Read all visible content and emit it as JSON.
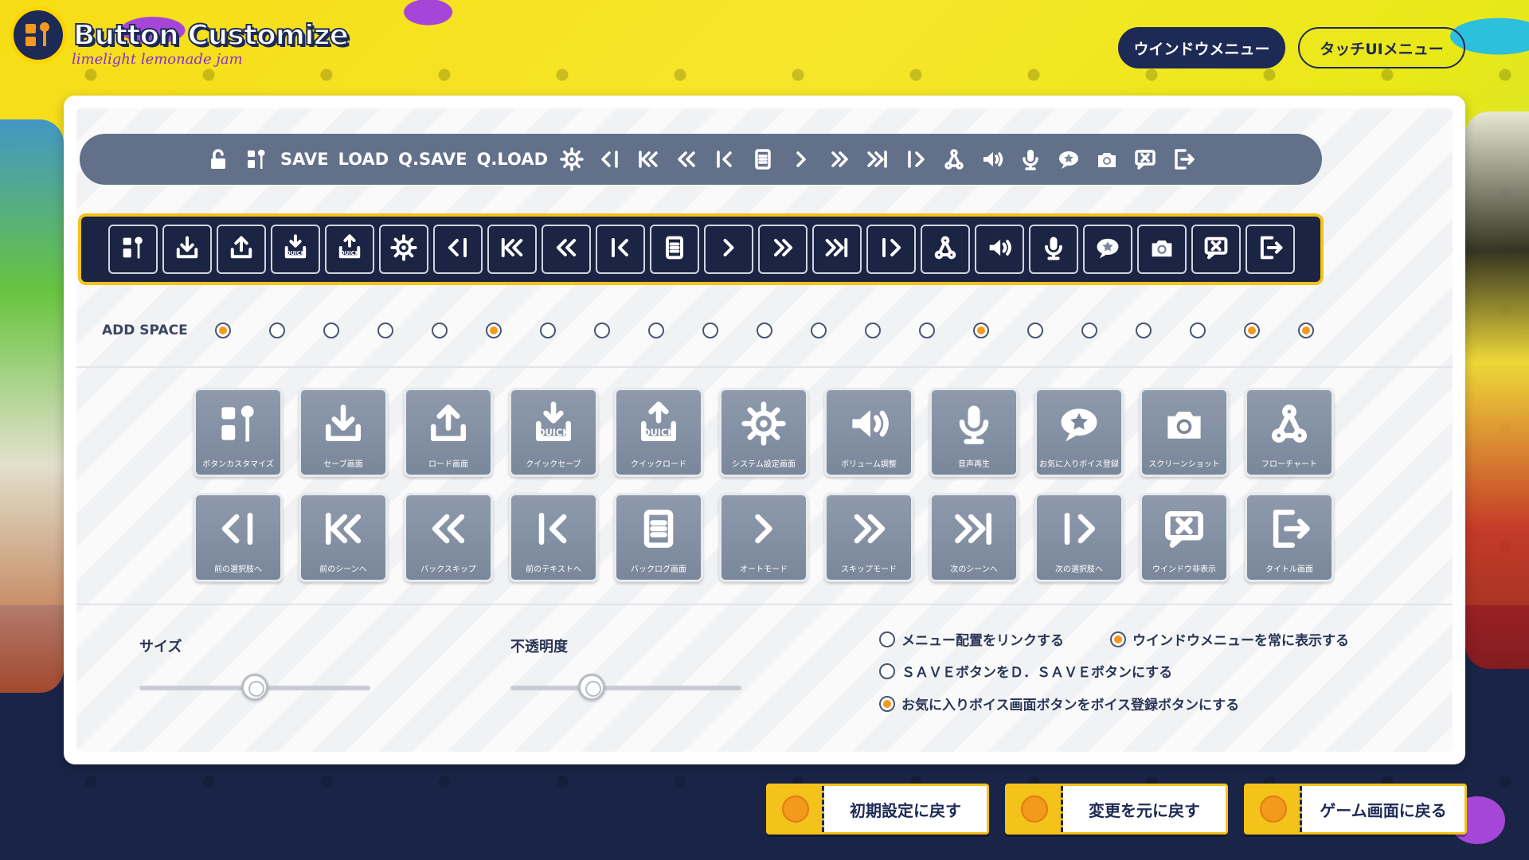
{
  "app": {
    "title": "Button Customize",
    "subtitle": "limelight lemonade jam"
  },
  "header": {
    "tabs": [
      {
        "label": "ウインドウメニュー",
        "active": true
      },
      {
        "label": "タッチUIメニュー",
        "active": false
      }
    ]
  },
  "preview_bar": {
    "items": [
      {
        "type": "icon",
        "icon": "lock-open-icon"
      },
      {
        "type": "icon",
        "icon": "button-customize-icon"
      },
      {
        "type": "text",
        "label": "SAVE"
      },
      {
        "type": "text",
        "label": "LOAD"
      },
      {
        "type": "text",
        "label": "Q.SAVE"
      },
      {
        "type": "text",
        "label": "Q.LOAD"
      },
      {
        "type": "icon",
        "icon": "gear-icon"
      },
      {
        "type": "icon",
        "icon": "prev-choice-icon"
      },
      {
        "type": "icon",
        "icon": "prev-scene-icon"
      },
      {
        "type": "icon",
        "icon": "back-skip-icon"
      },
      {
        "type": "icon",
        "icon": "prev-text-icon"
      },
      {
        "type": "icon",
        "icon": "backlog-icon"
      },
      {
        "type": "icon",
        "icon": "auto-icon"
      },
      {
        "type": "icon",
        "icon": "skip-icon"
      },
      {
        "type": "icon",
        "icon": "next-scene-icon"
      },
      {
        "type": "icon",
        "icon": "next-choice-icon"
      },
      {
        "type": "icon",
        "icon": "flowchart-icon"
      },
      {
        "type": "icon",
        "icon": "volume-icon"
      },
      {
        "type": "icon",
        "icon": "microphone-icon"
      },
      {
        "type": "icon",
        "icon": "favorite-voice-icon"
      },
      {
        "type": "icon",
        "icon": "camera-icon"
      },
      {
        "type": "icon",
        "icon": "hide-window-icon"
      },
      {
        "type": "icon",
        "icon": "exit-title-icon"
      }
    ]
  },
  "slots": [
    "button-customize-icon",
    "save-icon",
    "load-icon",
    "quick-save-icon",
    "quick-load-icon",
    "gear-icon",
    "prev-choice-icon",
    "prev-scene-icon",
    "back-skip-icon",
    "prev-text-icon",
    "backlog-icon",
    "auto-icon",
    "skip-icon",
    "next-scene-icon",
    "next-choice-icon",
    "flowchart-icon",
    "volume-icon",
    "microphone-icon",
    "favorite-voice-icon",
    "camera-icon",
    "hide-window-icon",
    "exit-title-icon"
  ],
  "add_space": {
    "label": "ADD SPACE",
    "states": [
      true,
      false,
      false,
      false,
      false,
      true,
      false,
      false,
      false,
      false,
      false,
      false,
      false,
      false,
      true,
      false,
      false,
      false,
      false,
      true,
      true
    ]
  },
  "palette": {
    "row1": [
      {
        "icon": "button-customize-icon",
        "label": "ボタンカスタマイズ"
      },
      {
        "icon": "save-icon",
        "label": "セーブ画面"
      },
      {
        "icon": "load-icon",
        "label": "ロード画面"
      },
      {
        "icon": "quick-save-icon",
        "label": "クイックセーブ"
      },
      {
        "icon": "quick-load-icon",
        "label": "クイックロード"
      },
      {
        "icon": "gear-icon",
        "label": "システム設定画面"
      },
      {
        "icon": "volume-icon",
        "label": "ボリューム調整"
      },
      {
        "icon": "microphone-icon",
        "label": "音声再生"
      },
      {
        "icon": "favorite-voice-icon",
        "label": "お気に入りボイス登録"
      },
      {
        "icon": "camera-icon",
        "label": "スクリーンショット"
      },
      {
        "icon": "flowchart-icon",
        "label": "フローチャート"
      }
    ],
    "row2": [
      {
        "icon": "prev-choice-icon",
        "label": "前の選択肢へ"
      },
      {
        "icon": "prev-scene-icon",
        "label": "前のシーンへ"
      },
      {
        "icon": "back-skip-icon",
        "label": "バックスキップ"
      },
      {
        "icon": "prev-text-icon",
        "label": "前のテキストへ"
      },
      {
        "icon": "backlog-icon",
        "label": "バックログ画面"
      },
      {
        "icon": "auto-icon",
        "label": "オートモード"
      },
      {
        "icon": "skip-icon",
        "label": "スキップモード"
      },
      {
        "icon": "next-scene-icon",
        "label": "次のシーンへ"
      },
      {
        "icon": "next-choice-icon",
        "label": "次の選択肢へ"
      },
      {
        "icon": "hide-window-icon",
        "label": "ウインドウ非表示"
      },
      {
        "icon": "exit-title-icon",
        "label": "タイトル画面"
      }
    ]
  },
  "settings": {
    "size": {
      "label": "サイズ",
      "value": 0.5
    },
    "opacity": {
      "label": "不透明度",
      "value": 0.35
    },
    "options": [
      {
        "label": "メニュー配置をリンクする",
        "checked": false
      },
      {
        "label": "ウインドウメニューを常に表示する",
        "checked": true
      },
      {
        "label": "ＳＡＶＥボタンをＤ．ＳＡＶＥボタンにする",
        "checked": false
      },
      {
        "label": "お気に入りボイス画面ボタンをボイス登録ボタンにする",
        "checked": true
      }
    ]
  },
  "footer": {
    "buttons": [
      {
        "label": "初期設定に戻す"
      },
      {
        "label": "変更を元に戻す"
      },
      {
        "label": "ゲーム画面に戻る"
      }
    ]
  },
  "colors": {
    "panel_bar": "#627189",
    "slot_bar": "#1b2442",
    "accent": "#f39a1d",
    "yellow": "#f3c21b",
    "navy": "#1d2a55",
    "tile": "#7a879b"
  }
}
